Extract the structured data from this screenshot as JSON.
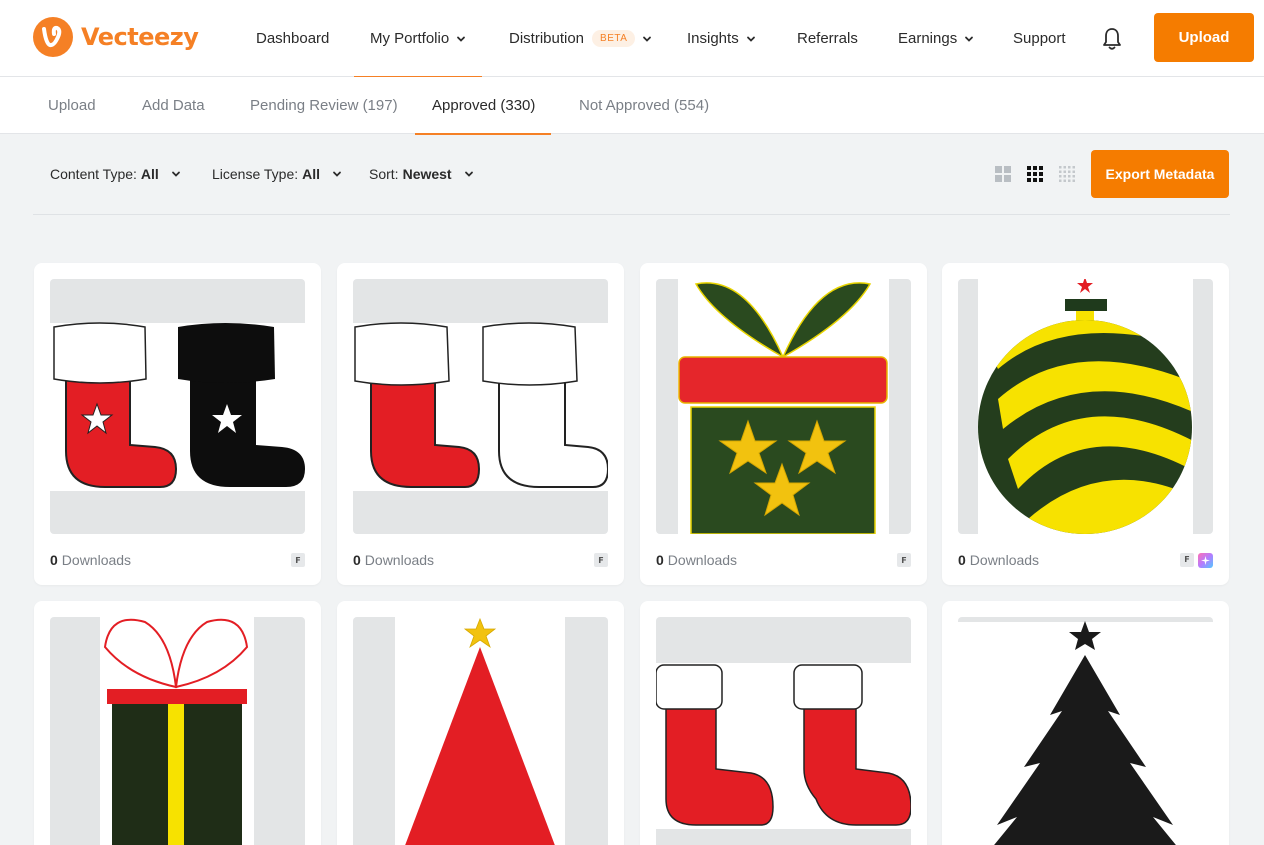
{
  "brand": {
    "name": "Vecteezy",
    "color": "#f58025"
  },
  "nav": {
    "items": [
      {
        "label": "Dashboard"
      },
      {
        "label": "My Portfolio"
      },
      {
        "label": "Distribution",
        "badge": "BETA"
      },
      {
        "label": "Insights"
      },
      {
        "label": "Referrals"
      },
      {
        "label": "Earnings"
      },
      {
        "label": "Support"
      }
    ],
    "upload_label": "Upload"
  },
  "subtabs": [
    {
      "label": "Upload"
    },
    {
      "label": "Add Data"
    },
    {
      "label": "Pending Review (197)"
    },
    {
      "label": "Approved (330)",
      "active": true
    },
    {
      "label": "Not Approved (554)"
    }
  ],
  "filters": {
    "content_type": {
      "label": "Content Type:",
      "value": "All"
    },
    "license_type": {
      "label": "License Type:",
      "value": "All"
    },
    "sort": {
      "label": "Sort:",
      "value": "Newest"
    },
    "export_label": "Export Metadata"
  },
  "cards": [
    {
      "name": "stockings-red-black",
      "downloads": "0",
      "downloads_label": "Downloads",
      "badge": "F",
      "ai": false
    },
    {
      "name": "stockings-red-white",
      "downloads": "0",
      "downloads_label": "Downloads",
      "badge": "F",
      "ai": false
    },
    {
      "name": "gift-box-stars",
      "downloads": "0",
      "downloads_label": "Downloads",
      "badge": "F",
      "ai": false
    },
    {
      "name": "striped-ornament",
      "downloads": "0",
      "downloads_label": "Downloads",
      "badge": "F",
      "ai": true
    },
    {
      "name": "gift-box-ribbon"
    },
    {
      "name": "red-christmas-tree"
    },
    {
      "name": "stockings-red-pair"
    },
    {
      "name": "black-tree-silhouette"
    }
  ],
  "colors": {
    "accent": "#f57c00",
    "active_tab_underline": "#f58025"
  }
}
